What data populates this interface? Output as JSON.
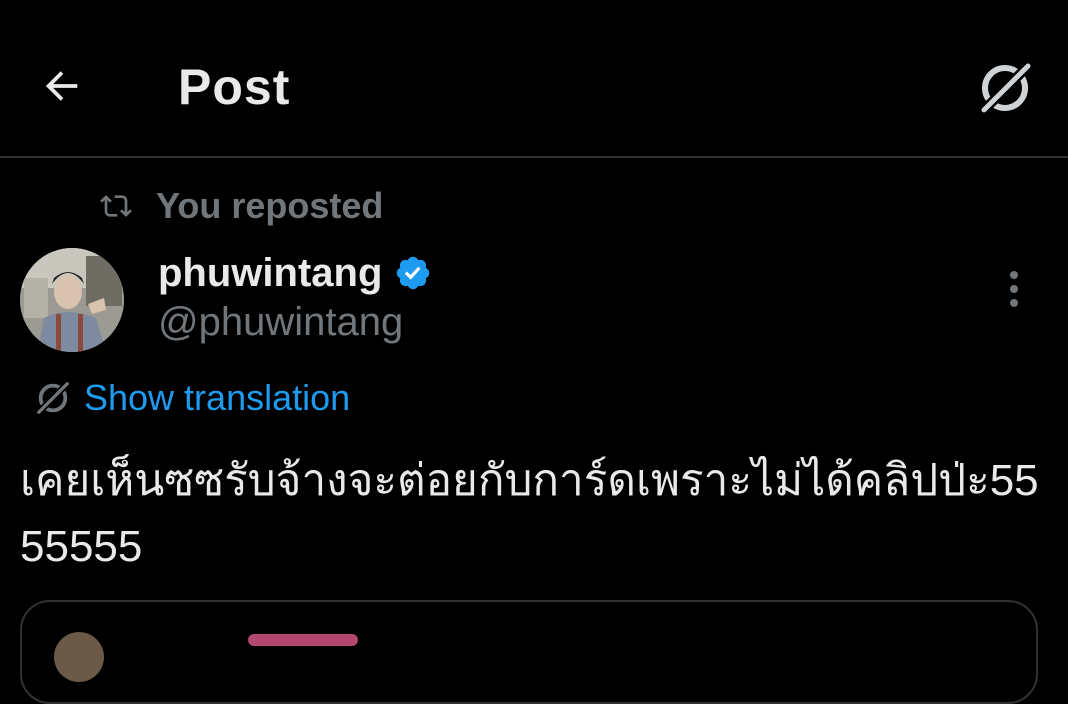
{
  "header": {
    "title": "Post",
    "back_icon": "arrow-left-icon",
    "grok_icon": "grok-icon"
  },
  "social_context": {
    "icon": "repost-icon",
    "text": "You reposted"
  },
  "post": {
    "author": {
      "display_name": "phuwintang",
      "handle": "@phuwintang",
      "verified": true,
      "verified_color": "#1d9bf0"
    },
    "more_icon": "more-vertical-icon",
    "translation": {
      "icon": "grok-icon",
      "label": "Show translation"
    },
    "text": "เคยเห็นซซรับจ้างจะต่อยกับการ์ดเพราะไม่ได้คลิปป่ะ5555555"
  },
  "colors": {
    "background": "#000000",
    "primary_text": "#e7e9ea",
    "secondary_text": "#71767b",
    "accent": "#1d9bf0",
    "divider": "#2f3336"
  }
}
